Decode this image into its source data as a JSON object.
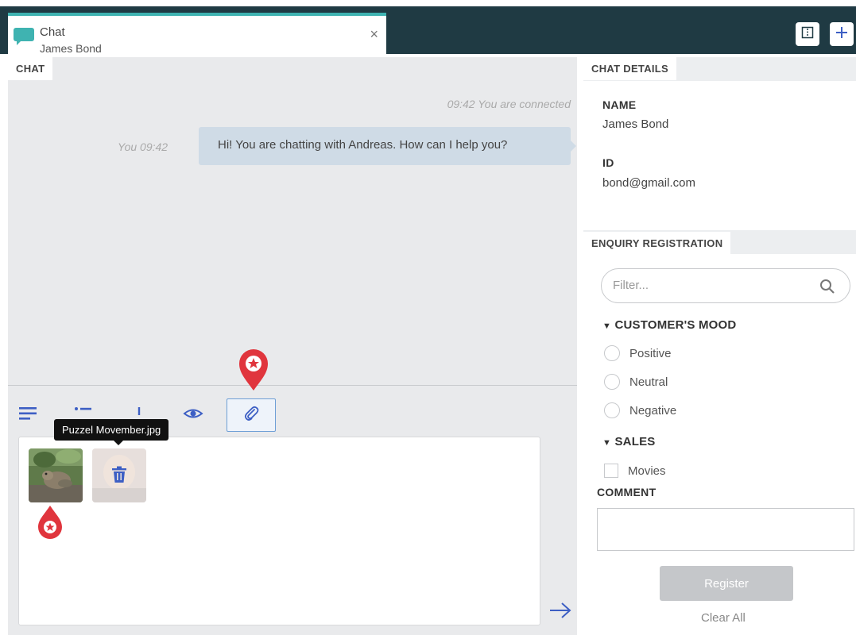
{
  "tab": {
    "title": "Chat",
    "subtitle": "James Bond",
    "close_glyph": "×",
    "icon": "chat-bubble-icon"
  },
  "header_buttons": [
    {
      "icon": "split-view-icon"
    },
    {
      "icon": "plus-icon"
    }
  ],
  "chat": {
    "section_label": "CHAT",
    "system_message": "09:42 You are connected",
    "messages": [
      {
        "meta": "You 09:42",
        "text": "Hi! You are chatting with Andreas. How can I help you?"
      }
    ]
  },
  "composer": {
    "tools": [
      "text-format-icon",
      "list-icon",
      "plus-icon",
      "preview-eye-icon",
      "paperclip-icon"
    ],
    "tooltip": "Puzzel Movember.jpg",
    "attachments": [
      {
        "name": "Puzzel Movember.jpg",
        "icon": "image-thumbnail"
      },
      {
        "icon": "trash-icon"
      }
    ],
    "send_icon": "arrow-right-icon"
  },
  "details": {
    "section_label": "CHAT DETAILS",
    "name_label": "NAME",
    "name_value": "James Bond",
    "id_label": "ID",
    "id_value": "bond@gmail.com"
  },
  "enquiry": {
    "section_label": "ENQUIRY REGISTRATION",
    "filter_placeholder": "Filter...",
    "groups": [
      {
        "label": "CUSTOMER'S MOOD",
        "options": [
          "Positive",
          "Neutral",
          "Negative"
        ]
      },
      {
        "label": "SALES",
        "options": [
          "Movies"
        ]
      }
    ],
    "comment_label": "COMMENT",
    "register_label": "Register",
    "clear_label": "Clear All"
  },
  "colors": {
    "topbar": "#1f3a43",
    "tab_accent": "#3fb3b1",
    "bubble": "#cfdbe6",
    "accent_blue": "#3d5fc4",
    "marker_red": "#e0353d"
  }
}
